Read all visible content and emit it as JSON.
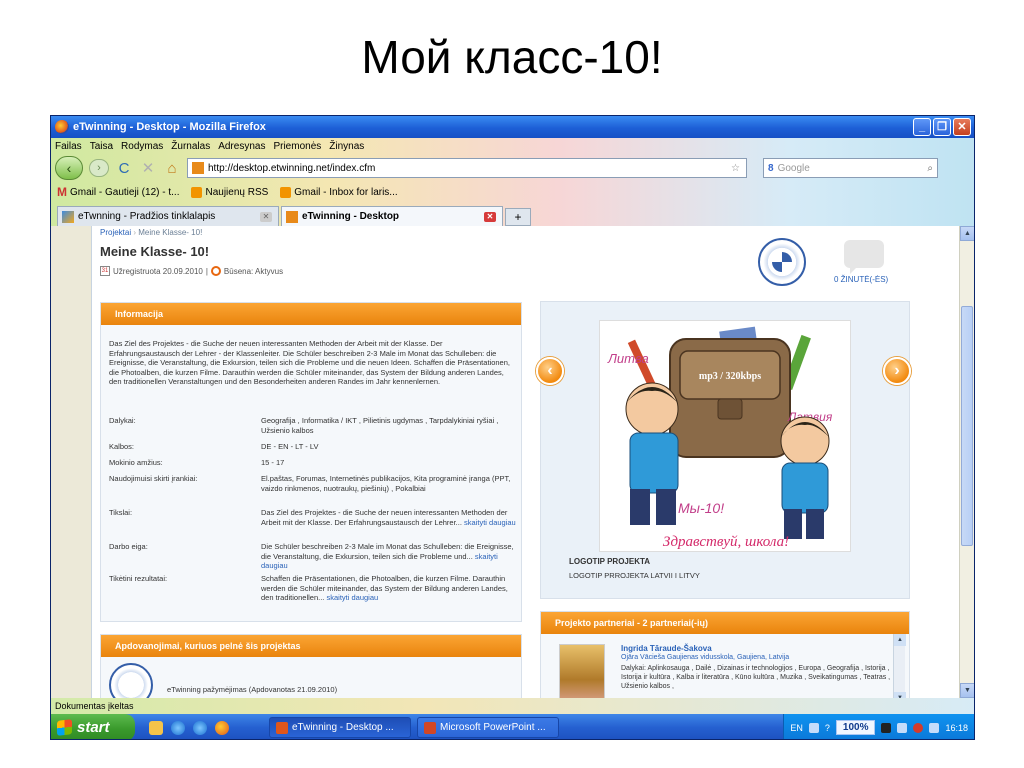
{
  "slide": {
    "title": "Мой класс-10!"
  },
  "window": {
    "title": "eTwinning - Desktop - Mozilla Firefox",
    "controls": {
      "minimize": "_",
      "restore": "❐",
      "close": "✕"
    }
  },
  "menu": [
    "Failas",
    "Taisa",
    "Rodymas",
    "Žurnalas",
    "Adresynas",
    "Priemonės",
    "Žinynas"
  ],
  "nav": {
    "back": "‹",
    "forward": "›",
    "reload": "C",
    "stop": "✕",
    "home": "⌂",
    "url": "http://desktop.etwinning.net/index.cfm",
    "star": "☆",
    "search_engine": "8",
    "search_placeholder": "Google",
    "search_icon": "⌕"
  },
  "bookmarks": [
    {
      "label": "Gmail - Gautieji (12) - t...",
      "icon": "gmail-icon"
    },
    {
      "label": "Naujienų RSS",
      "icon": "rss-icon"
    },
    {
      "label": "Gmail - Inbox for laris...",
      "icon": "gmail-icon"
    }
  ],
  "tabs": [
    {
      "label": "eTwnning - Pradžios tinklalapis",
      "active": false
    },
    {
      "label": "eTwinning - Desktop",
      "active": true
    }
  ],
  "newtab_label": "+",
  "page": {
    "breadcrumb": {
      "root": "Projektai",
      "separator": "›",
      "current": "Meine Klasse- 10!"
    },
    "title": "Meine Klasse- 10!",
    "registered": "Užregistruota 20.09.2010",
    "meta_separator": "|",
    "status": "Būsena: Aktyvus",
    "calendar_day": "31",
    "messages": "0 ŽINUTĖ(-ĖS)",
    "info": {
      "heading": "Informacija",
      "description": "Das Ziel des Projektes - die Suche der neuen interessanten Methoden der Arbeit mit der Klasse. Der Erfahrungsaustausch der Lehrer - der Klassenleiter. Die Schüler beschreiben 2-3 Male im Monat das Schulleben: die Ereignisse, die Veranstaltung, die Exkursion, teilen sich die Probleme und die neuen Ideen. Schaffen die Präsentationen, die Photoalben, die kurzen Filme. Darauthin werden die Schüler miteinander, das System der Bildung anderen Landes, den traditionellen Veranstaltungen und den Besonderheiten anderen Randes im Jahr kennenlernen.",
      "rows": [
        {
          "label": "Dalykai:",
          "value": "Geografija , Informatika / IKT , Pilietinis ugdymas , Tarpdalykiniai ryšiai , Užsienio kalbos"
        },
        {
          "label": "Kalbos:",
          "value": "DE - EN - LT - LV"
        },
        {
          "label": "Mokinio amžius:",
          "value": "15 - 17"
        },
        {
          "label": "Naudojimuisi skirti įrankiai:",
          "value": "El.paštas, Forumas, Internetinės publikacijos, Kita programinė įranga (PPT, vaizdo rinkmenos, nuotraukų, piešinių) , Pokalbiai"
        },
        {
          "label": "Tikslai:",
          "value": "Das Ziel des Projektes - die Suche der neuen interessanten Methoden der Arbeit mit der Klasse. Der Erfahrungsaustausch der Lehrer...",
          "more": "skaityti daugiau"
        },
        {
          "label": "Darbo eiga:",
          "value": "Die Schüler beschreiben 2-3 Male im Monat das Schulleben: die Ereignisse, die Veranstaltung, die Exkursion, teilen sich die Probleme und...",
          "more": "skaityti daugiau"
        },
        {
          "label": "Tikėtini rezultatai:",
          "value": "Schaffen die Präsentationen, die Photoalben, die kurzen Filme. Darauthin werden die Schüler miteinander, das System der Bildung anderen Landes, den traditionellen...",
          "more": "skaityti daugiau"
        }
      ]
    },
    "awards": {
      "heading": "Apdovanojimai, kuriuos pelnė šis projektas",
      "item": "eTwinning pažymėjimas (Apdovanotas 21.09.2010)"
    },
    "gallery": {
      "arrow_left": "‹",
      "arrow_right": "›",
      "picture": {
        "label_left": "Литва",
        "label_right": "Латвия",
        "bag_label": "mp3 / 320kbps",
        "board_label": "Мы-10!",
        "banner": "Здравствуй, школа!"
      },
      "caption_title": "LOGOTIP PROJEKTA",
      "caption_sub": "LOGOTIP PRROJEKTA LATVII I LITVY"
    },
    "partners": {
      "heading": "Projekto partneriai - 2 partneriai(-ių)",
      "name": "Ingrida Tāraude-Šakova",
      "school": "Ojāra Vācieša Gaujienas vidusskola, Gaujiena, Latvija",
      "subjects": "Dalykai: Aplinkosauga , Dailė , Dizainas ir technologijos , Europa , Geografija , Istorija , Istorija ir kultūra , Kalba ir literatūra , Kūno kultūra , Muzika , Sveikatingumas , Teatras , Užsienio kalbos ,",
      "scroll_up": "▲",
      "scroll_down": "▼"
    }
  },
  "scrollbar": {
    "up": "▲",
    "down": "▼"
  },
  "statusbar": "Dokumentas įkeltas",
  "taskbar": {
    "start": "start",
    "tasks": [
      {
        "label": "eTwinning - Desktop ...",
        "icon": "firefox-icon"
      },
      {
        "label": "Microsoft PowerPoint ...",
        "icon": "powerpoint-icon"
      }
    ],
    "lang": "EN",
    "help": "?",
    "zoom": "100%",
    "time": "16:18"
  }
}
